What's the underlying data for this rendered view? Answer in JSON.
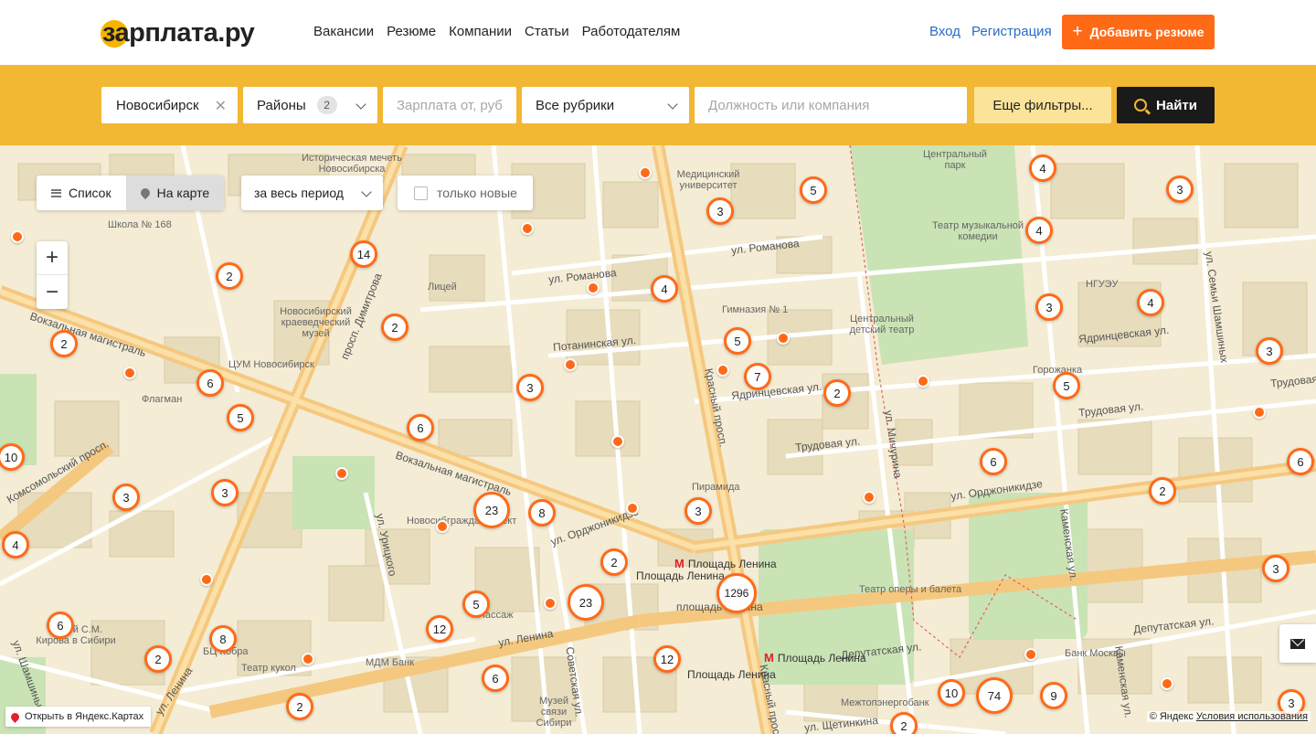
{
  "header": {
    "logo": "зарплата.ру",
    "nav": [
      "Вакансии",
      "Резюме",
      "Компании",
      "Статьи",
      "Работодателям"
    ],
    "login": "Вход",
    "register": "Регистрация",
    "add_resume": "Добавить резюме"
  },
  "search": {
    "city": "Новосибирск",
    "districts_label": "Районы",
    "districts_count": "2",
    "salary_placeholder": "Зарплата от, руб",
    "category": "Все рубрики",
    "query_placeholder": "Должность или компания",
    "more_filters": "Еще фильтры...",
    "find": "Найти"
  },
  "map_controls": {
    "list": "Список",
    "on_map": "На карте",
    "period": "за весь период",
    "only_new": "только новые",
    "zoom_in": "+",
    "zoom_out": "−",
    "open_yandex": "Открыть в Яндекс.Картах",
    "copyright": "© Яндекс",
    "terms": "Условия использования"
  },
  "streets": [
    "Вокзальная магистраль",
    "Вокзальная магистраль",
    "просп. Димитрова",
    "ул. Романова",
    "ул. Романова",
    "Потанинская ул.",
    "Красный просп.",
    "Ядринцевская ул.",
    "Ядринцевская ул.",
    "Трудовая ул.",
    "Трудовая ул.",
    "Трудовая ул.",
    "ул. Орджоникидзе",
    "ул. Орджоникидзе",
    "ул. Мичурина",
    "Каменская ул.",
    "Каменская ул.",
    "Депутатская ул.",
    "Депутатская ул.",
    "ул. Ленина",
    "ул. Ленина",
    "ул. Урицкого",
    "Советская ул.",
    "ул. Семьи Шамшиных",
    "ул. Щетинкина",
    "Красный просп.",
    "Комсомольский просп.",
    "ул. Шамшиных",
    "площадь Ленина"
  ],
  "places": [
    "Историческая мечеть Новосибирска",
    "Медицинский университет",
    "Центральный парк",
    "Школа № 168",
    "Лицей",
    "Гимназия № 1",
    "Театр музыкальной комедии",
    "НГУЭУ",
    "Новосибирский краеведческий музей",
    "ЦУМ Новосибирск",
    "Центральный детский театр",
    "Флагман",
    "Горожанка",
    "Пирамида",
    "Новосибгражданпроект",
    "Театр оперы и балета",
    "Пассаж",
    "МДМ Банк",
    "Театр кукол",
    "Банк Москвы",
    "Межтопэнергобанк",
    "Музей связи Сибири",
    "Музей С.М. Кирова в Сибири",
    "БЦ Кобра"
  ],
  "metro": [
    "Площадь Ленина",
    "Площадь Ленина",
    "Площадь Ленина",
    "Площадь Ленина"
  ],
  "clusters": [
    "14",
    "2",
    "2",
    "2",
    "6",
    "5",
    "10",
    "3",
    "3",
    "4",
    "6",
    "2",
    "8",
    "3",
    "6",
    "23",
    "8",
    "5",
    "12",
    "23",
    "2",
    "6",
    "12",
    "3",
    "5",
    "4",
    "3",
    "7",
    "2",
    "5",
    "3",
    "1296",
    "6",
    "5",
    "4",
    "4",
    "3",
    "4",
    "3",
    "5",
    "3",
    "2",
    "6",
    "3",
    "10",
    "74",
    "9",
    "2",
    "2",
    "3",
    "3"
  ]
}
